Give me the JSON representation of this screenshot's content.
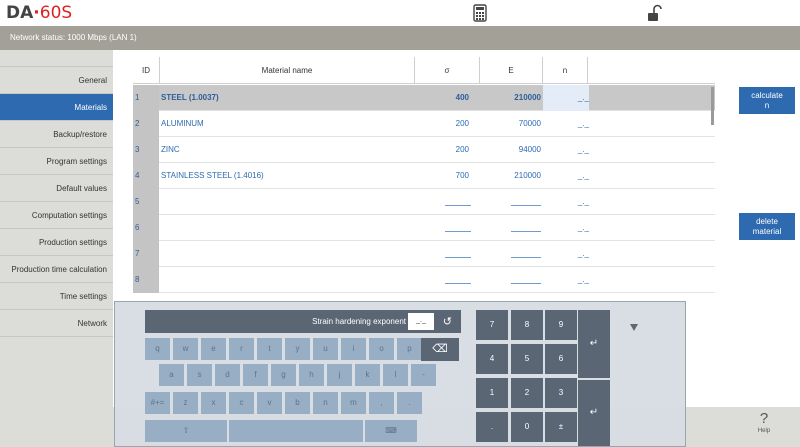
{
  "header": {
    "logo_prefix": "DA",
    "logo_dot": "·",
    "logo_model": "60S",
    "icons": [
      "calculator-icon",
      "unlock-icon"
    ]
  },
  "status": {
    "network": "Network status: 1000 Mbps (LAN 1)"
  },
  "sidebar": {
    "items": [
      {
        "label": "General",
        "active": false
      },
      {
        "label": "Materials",
        "active": true
      },
      {
        "label": "Backup/restore",
        "active": false
      },
      {
        "label": "Program settings",
        "active": false
      },
      {
        "label": "Default values",
        "active": false
      },
      {
        "label": "Computation settings",
        "active": false
      },
      {
        "label": "Production settings",
        "active": false
      },
      {
        "label": "Production time calculation",
        "active": false
      },
      {
        "label": "Time settings",
        "active": false
      },
      {
        "label": "Network",
        "active": false
      }
    ]
  },
  "table": {
    "columns": {
      "id": "ID",
      "name": "Material name",
      "sigma": "σ",
      "e": "E",
      "n": "n"
    },
    "rows": [
      {
        "id": "1",
        "name": "STEEL (1.0037)",
        "sigma": "400",
        "e": "210000",
        "n": "_._"
      },
      {
        "id": "2",
        "name": "ALUMINUM",
        "sigma": "200",
        "e": "70000",
        "n": "_._"
      },
      {
        "id": "3",
        "name": "ZINC",
        "sigma": "200",
        "e": "94000",
        "n": "_._"
      },
      {
        "id": "4",
        "name": "STAINLESS STEEL (1.4016)",
        "sigma": "700",
        "e": "210000",
        "n": "_._"
      },
      {
        "id": "5",
        "name": "",
        "sigma": "",
        "e": "",
        "n": "_._"
      },
      {
        "id": "6",
        "name": "",
        "sigma": "",
        "e": "",
        "n": "_._"
      },
      {
        "id": "7",
        "name": "",
        "sigma": "",
        "e": "",
        "n": "_._"
      },
      {
        "id": "8",
        "name": "",
        "sigma": "",
        "e": "",
        "n": "_._"
      }
    ]
  },
  "buttons": {
    "calculate": "calculate",
    "calculate_sub": "n",
    "delete": "delete",
    "delete_sub": "material"
  },
  "keyboard": {
    "title": "Strain hardening exponent",
    "field_value": "_._",
    "row1": [
      "q",
      "w",
      "e",
      "r",
      "t",
      "y",
      "u",
      "i",
      "o",
      "p"
    ],
    "row2": [
      "a",
      "s",
      "d",
      "f",
      "g",
      "h",
      "j",
      "k",
      "l",
      "-"
    ],
    "row3": [
      "#+=",
      "z",
      "x",
      "c",
      "v",
      "b",
      "n",
      "m",
      ",",
      "."
    ],
    "shift": "⇧",
    "space_alt": "⌨",
    "numpad": [
      "7",
      "8",
      "9",
      "4",
      "5",
      "6",
      "1",
      "2",
      "3",
      ".",
      "0",
      "±"
    ]
  },
  "help": {
    "symbol": "?",
    "label": "Help"
  },
  "colors": {
    "accent": "#2d6ab0",
    "status_bar": "#a3a097",
    "sidebar": "#dcdcd8",
    "key_dark": "#5b6675",
    "key_light": "#98aec5"
  }
}
